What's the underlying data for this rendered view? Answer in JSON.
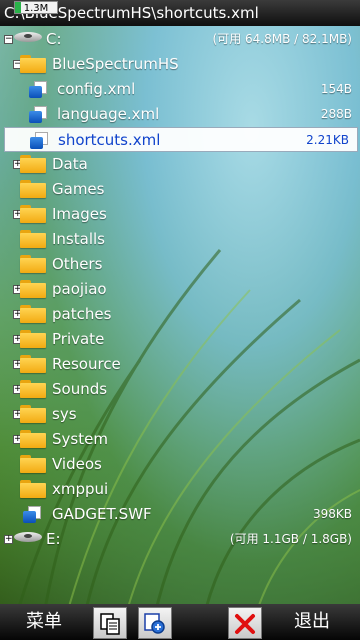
{
  "title": "C:\\BlueSpectrumHS\\shortcuts.xml",
  "memory_badge": "1.3M",
  "rows": [
    {
      "name": "C:",
      "meta": "(可用 64.8MB / 82.1MB)",
      "icon": "drive-icon",
      "expander": "−"
    },
    {
      "name": "BlueSpectrumHS",
      "meta": "",
      "icon": "folder-icon",
      "expander": "−"
    },
    {
      "name": "config.xml",
      "meta": "154B",
      "icon": "file-icon",
      "expander": ""
    },
    {
      "name": "language.xml",
      "meta": "288B",
      "icon": "file-icon",
      "expander": ""
    },
    {
      "name": "shortcuts.xml",
      "meta": "2.21KB",
      "icon": "file-icon",
      "expander": "",
      "selected": true
    },
    {
      "name": "Data",
      "meta": "",
      "icon": "folder-icon",
      "expander": "+"
    },
    {
      "name": "Games",
      "meta": "",
      "icon": "folder-icon",
      "expander": ""
    },
    {
      "name": "Images",
      "meta": "",
      "icon": "folder-icon",
      "expander": "+"
    },
    {
      "name": "Installs",
      "meta": "",
      "icon": "folder-icon",
      "expander": ""
    },
    {
      "name": "Others",
      "meta": "",
      "icon": "folder-icon",
      "expander": ""
    },
    {
      "name": "paojiao",
      "meta": "",
      "icon": "folder-icon",
      "expander": "+"
    },
    {
      "name": "patches",
      "meta": "",
      "icon": "folder-icon",
      "expander": "+"
    },
    {
      "name": "Private",
      "meta": "",
      "icon": "folder-icon",
      "expander": "+"
    },
    {
      "name": "Resource",
      "meta": "",
      "icon": "folder-icon",
      "expander": "+"
    },
    {
      "name": "Sounds",
      "meta": "",
      "icon": "folder-icon",
      "expander": "+"
    },
    {
      "name": "sys",
      "meta": "",
      "icon": "folder-icon",
      "expander": "+"
    },
    {
      "name": "System",
      "meta": "",
      "icon": "folder-icon",
      "expander": "+"
    },
    {
      "name": "Videos",
      "meta": "",
      "icon": "folder-icon",
      "expander": ""
    },
    {
      "name": "xmppui",
      "meta": "",
      "icon": "folder-icon",
      "expander": ""
    },
    {
      "name": "GADGET.SWF",
      "meta": "398KB",
      "icon": "file-icon",
      "expander": ""
    },
    {
      "name": "E:",
      "meta": "(可用 1.1GB / 1.8GB)",
      "icon": "drive-icon",
      "expander": "+"
    }
  ],
  "bottom_bar": {
    "left_softkey": "菜单",
    "right_softkey": "退出",
    "copy_icon": "copy-icon",
    "paste_icon": "paste-icon",
    "delete_icon": "delete-icon"
  }
}
